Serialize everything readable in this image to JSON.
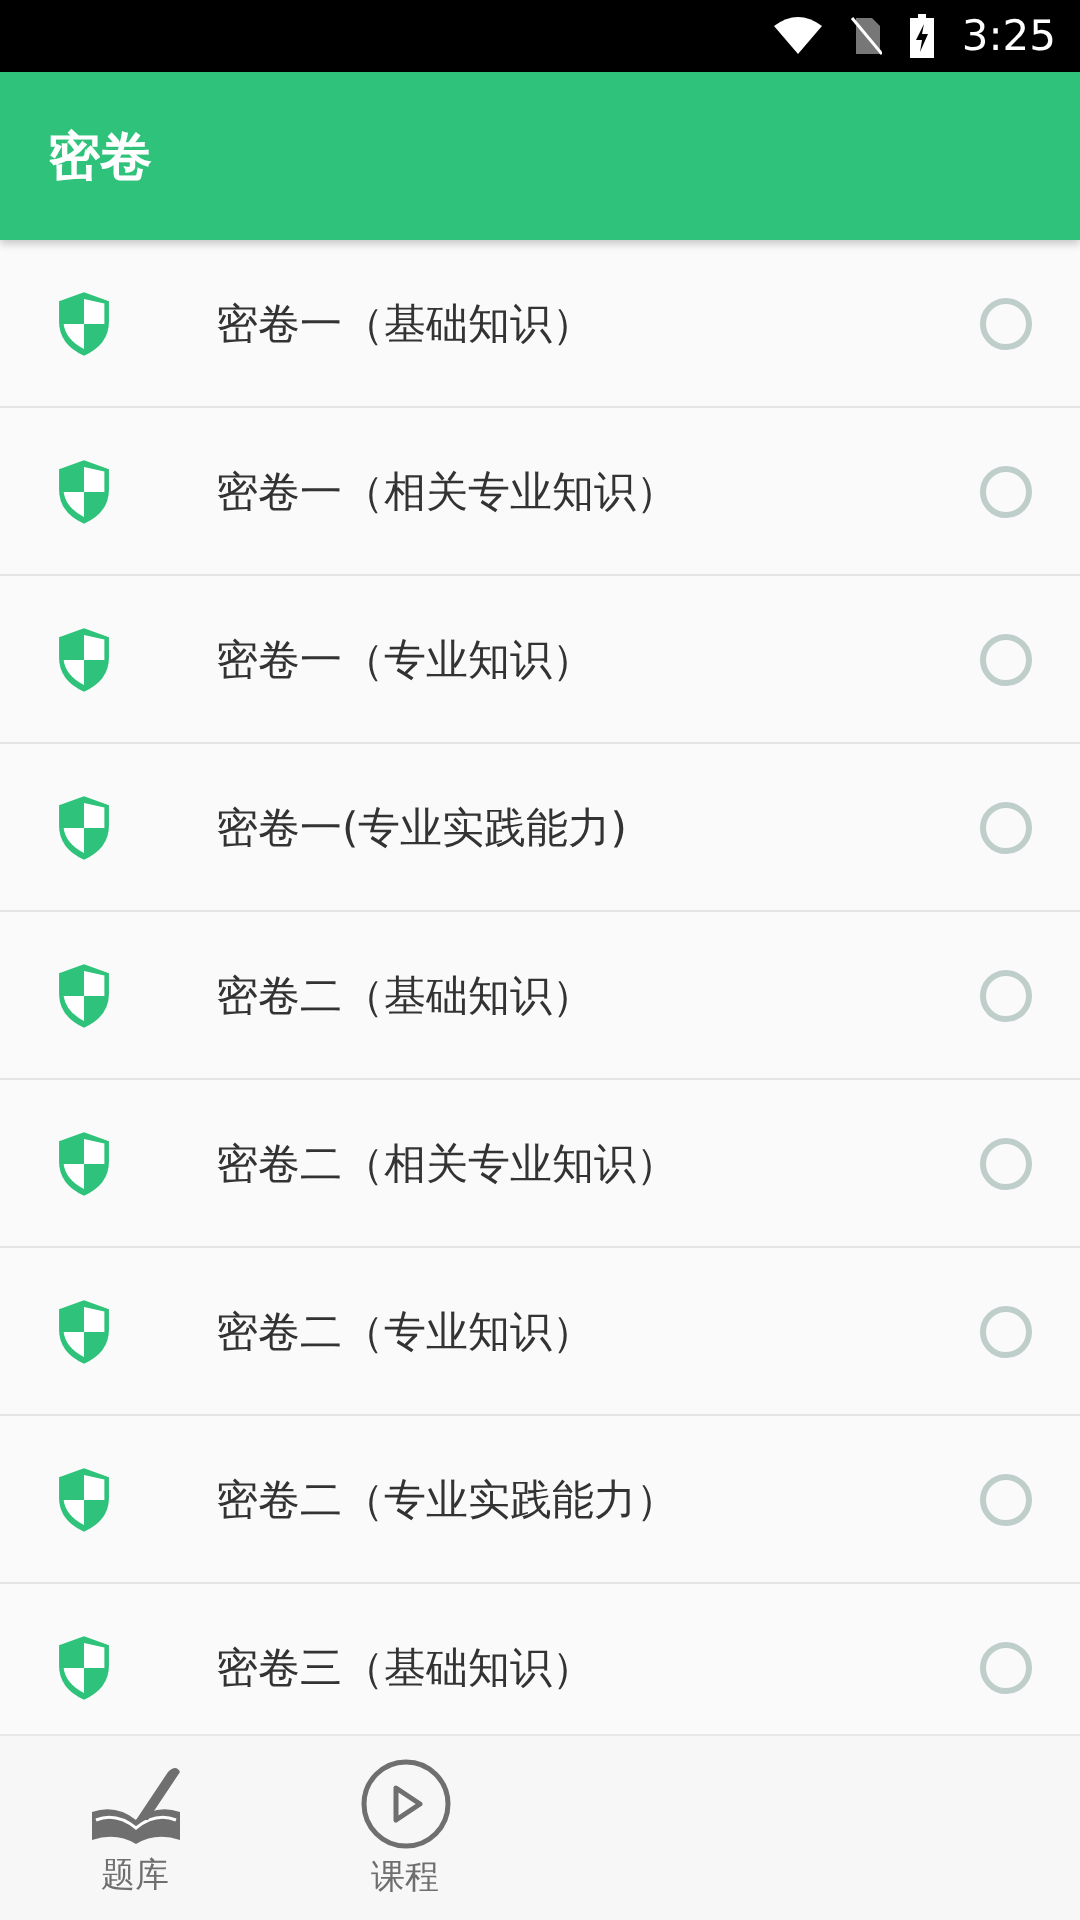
{
  "status_bar": {
    "time": "3:25"
  },
  "app_bar": {
    "title": "密卷"
  },
  "papers": [
    {
      "title": "密卷一（基础知识）",
      "checked": false
    },
    {
      "title": "密卷一（相关专业知识）",
      "checked": false
    },
    {
      "title": "密卷一（专业知识）",
      "checked": false
    },
    {
      "title": "密卷一(专业实践能力)",
      "checked": false
    },
    {
      "title": "密卷二（基础知识）",
      "checked": false
    },
    {
      "title": "密卷二（相关专业知识）",
      "checked": false
    },
    {
      "title": "密卷二（专业知识）",
      "checked": false
    },
    {
      "title": "密卷二（专业实践能力）",
      "checked": false
    },
    {
      "title": "密卷三（基础知识）",
      "checked": false
    }
  ],
  "bottom_nav": [
    {
      "label": "题库",
      "kind": "book"
    },
    {
      "label": "课程",
      "kind": "play"
    }
  ]
}
